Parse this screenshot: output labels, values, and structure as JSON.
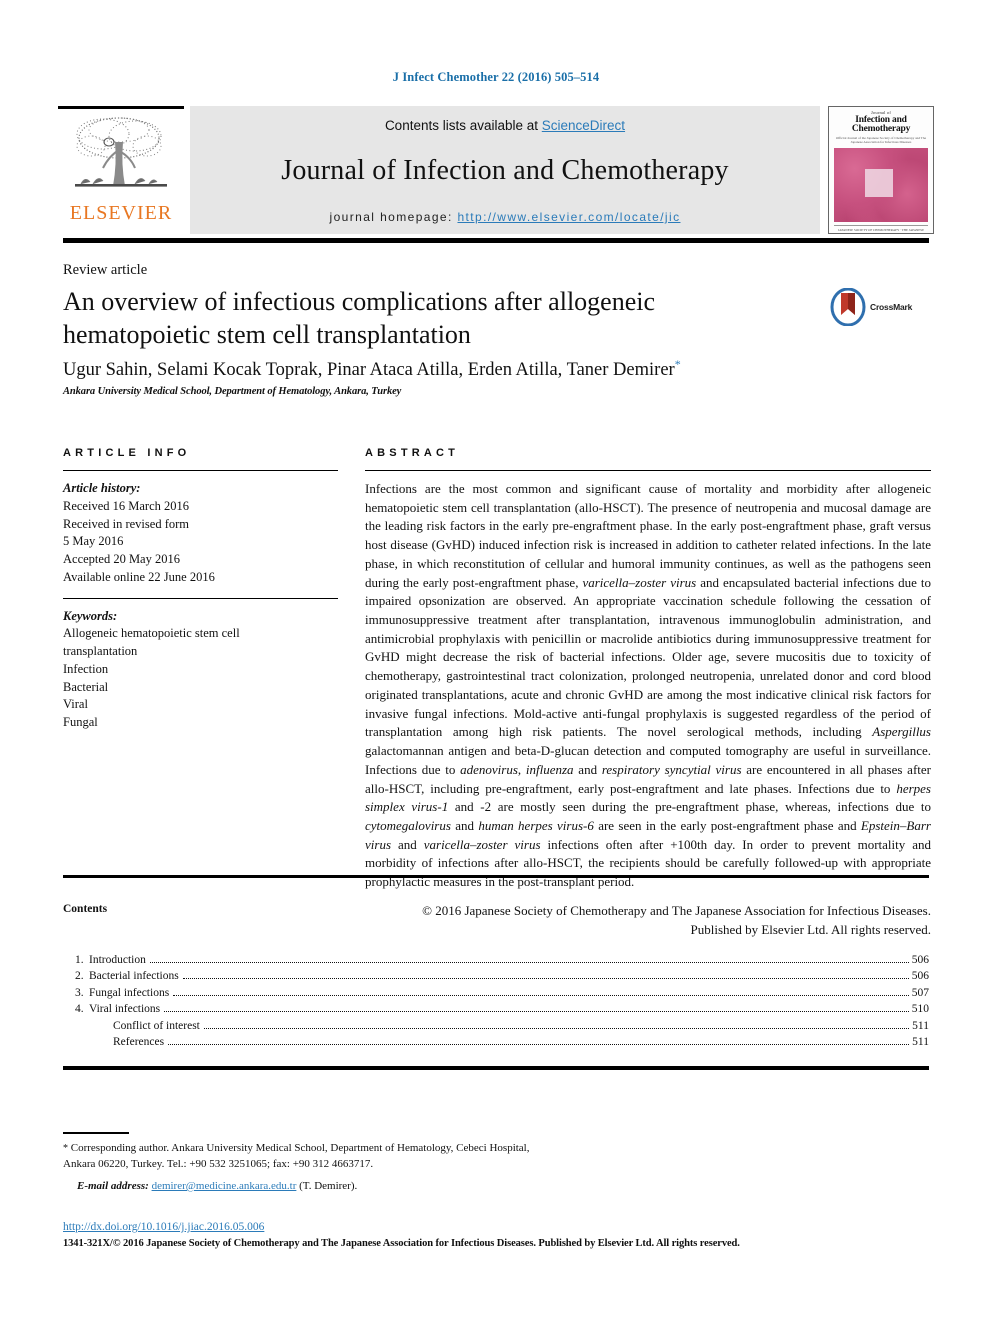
{
  "running_head": "J Infect Chemother 22 (2016) 505–514",
  "masthead": {
    "publisher_name": "ELSEVIER",
    "contents_prefix": "Contents lists available at ",
    "sciencedirect_label": "ScienceDirect",
    "journal_title": "Journal of Infection and Chemotherapy",
    "homepage_label": "journal homepage:",
    "homepage_url": "http://www.elsevier.com/locate/jic",
    "cover": {
      "line1": "Journal of",
      "line2": "Infection and Chemotherapy",
      "line3": "Official Journal of the Japanese Society of Chemotherapy and The Japanese Association for Infectious Diseases",
      "footer": "JAPANESE SOCIETY OF CHEMOTHERAPY · THE JAPANESE ASSOCIATION FOR INFECTIOUS DISEASES"
    }
  },
  "article": {
    "type": "Review article",
    "title": "An overview of infectious complications after allogeneic hematopoietic stem cell transplantation",
    "authors": "Ugur Sahin, Selami Kocak Toprak, Pinar Ataca Atilla, Erden Atilla, Taner Demirer",
    "corresponding_marker": "*",
    "affiliation": "Ankara University Medical School, Department of Hematology, Ankara, Turkey",
    "crossmark_label": "CrossMark"
  },
  "article_info": {
    "heading": "ARTICLE INFO",
    "history_label": "Article history:",
    "history": [
      "Received 16 March 2016",
      "Received in revised form",
      "5 May 2016",
      "Accepted 20 May 2016",
      "Available online 22 June 2016"
    ],
    "keywords_label": "Keywords:",
    "keywords": [
      "Allogeneic hematopoietic stem cell",
      "transplantation",
      "Infection",
      "Bacterial",
      "Viral",
      "Fungal"
    ]
  },
  "abstract": {
    "heading": "ABSTRACT",
    "body_html": "Infections are the most common and significant cause of mortality and morbidity after allogeneic hematopoietic stem cell transplantation (allo-HSCT). The presence of neutropenia and mucosal damage are the leading risk factors in the early pre-engraftment phase. In the early post-engraftment phase, graft versus host disease (GvHD) induced infection risk is increased in addition to catheter related infections. In the late phase, in which reconstitution of cellular and humoral immunity continues, as well as the pathogens seen during the early post-engraftment phase, <i>varicella&#8211;zoster virus</i> and encapsulated bacterial infections due to impaired opsonization are observed. An appropriate vaccination schedule following the cessation of immunosuppressive treatment after transplantation, intravenous immunoglobulin administration, and antimicrobial prophylaxis with penicillin or macrolide antibiotics during immunosuppressive treatment for GvHD might decrease the risk of bacterial infections. Older age, severe mucositis due to toxicity of chemotherapy, gastrointestinal tract colonization, prolonged neutropenia, unrelated donor and cord blood originated transplantations, acute and chronic GvHD are among the most indicative clinical risk factors for invasive fungal infections. Mold-active anti-fungal prophylaxis is suggested regardless of the period of transplantation among high risk patients. The novel serological methods, including <i>Aspergillus</i> galactomannan antigen and beta-D-glucan detection and computed tomography are useful in surveillance. Infections due to <i>adenovirus</i>, <i>influenza</i> and <i>respiratory syncytial virus</i> are encountered in all phases after allo-HSCT, including pre-engraftment, early post-engraftment and late phases. Infections due to <i>herpes simplex virus-1</i> and -2 are mostly seen during the pre-engraftment phase, whereas, infections due to <i>cytomegalovirus</i> and <i>human herpes virus-6</i> are seen in the early post-engraftment phase and <i>Epstein&#8211;Barr virus</i> and <i>varicella&#8211;zoster virus</i> infections often after +100th day. In order to prevent mortality and morbidity of infections after allo-HSCT, the recipients should be carefully followed-up with appropriate prophylactic measures in the post-transplant period.",
    "copyright_line_1": "© 2016 Japanese Society of Chemotherapy and The Japanese Association for Infectious Diseases.",
    "copyright_line_2": "Published by Elsevier Ltd. All rights reserved."
  },
  "contents": {
    "heading": "Contents",
    "rows": [
      {
        "num": "1.",
        "label": "Introduction",
        "page": "506",
        "sub": false
      },
      {
        "num": "2.",
        "label": "Bacterial infections",
        "page": "506",
        "sub": false
      },
      {
        "num": "3.",
        "label": "Fungal infections",
        "page": "507",
        "sub": false
      },
      {
        "num": "4.",
        "label": "Viral infections",
        "page": "510",
        "sub": false
      },
      {
        "num": "",
        "label": "Conflict of interest",
        "page": "511",
        "sub": true
      },
      {
        "num": "",
        "label": "References",
        "page": "511",
        "sub": true
      }
    ]
  },
  "footnote": {
    "marker": "*",
    "text": "Corresponding author. Ankara University Medical School, Department of Hematology, Cebeci Hospital, Ankara 06220, Turkey. Tel.: +90 532 3251065; fax: +90 312 4663717.",
    "email_label": "E-mail address:",
    "email": "demirer@medicine.ankara.edu.tr",
    "email_owner": "(T. Demirer)."
  },
  "doi": "http://dx.doi.org/10.1016/j.jiac.2016.05.006",
  "issn_line": "1341-321X/© 2016 Japanese Society of Chemotherapy and The Japanese Association for Infectious Diseases. Published by Elsevier Ltd. All rights reserved.",
  "colors": {
    "link_blue": "#2b7bb9",
    "header_blue": "#1a6fa8",
    "elsevier_orange": "#e87722",
    "band_gray": "#e6e6e6"
  }
}
